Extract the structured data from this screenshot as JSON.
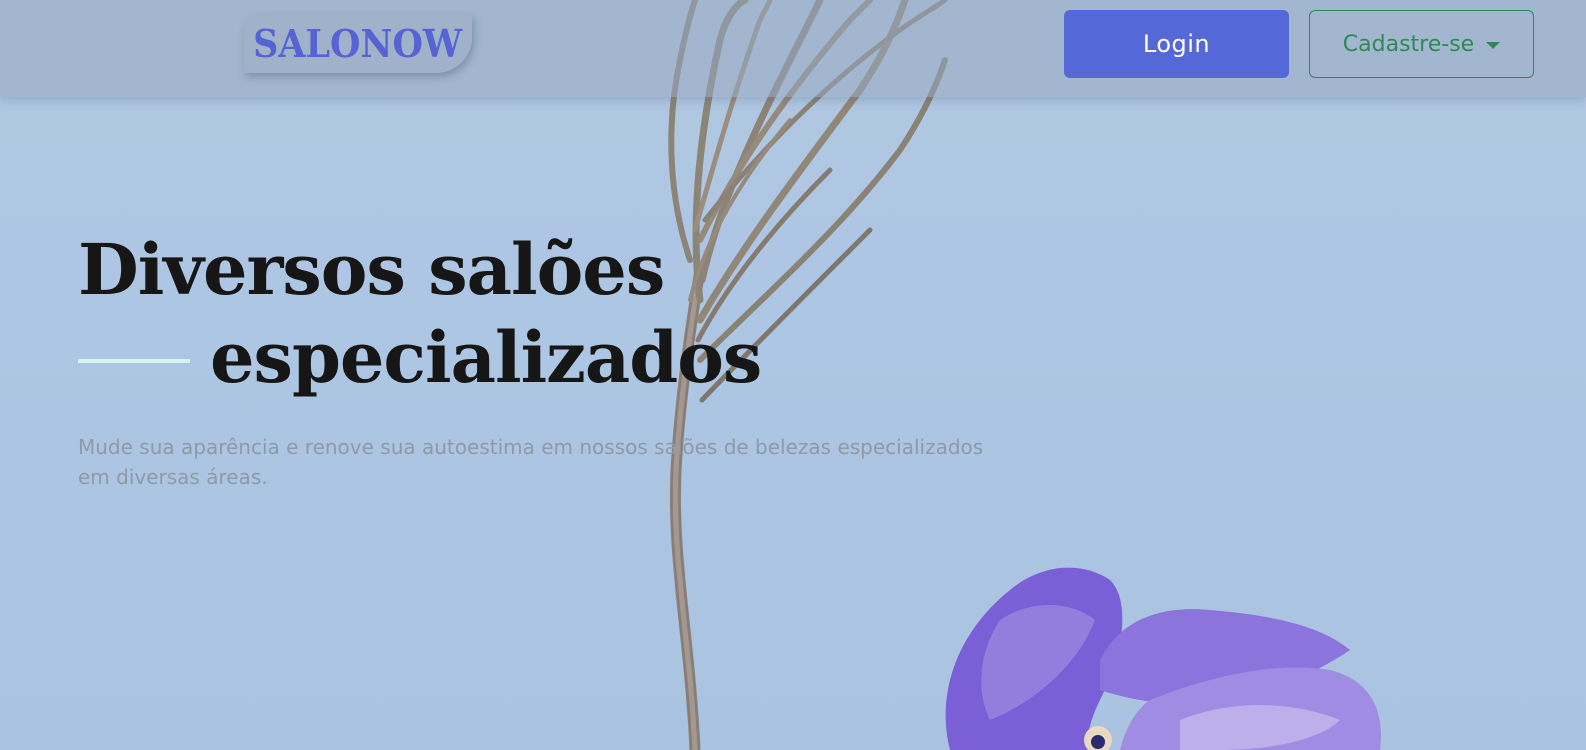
{
  "header": {
    "logo_text": "SALONOW",
    "login_label": "Login",
    "signup_label": "Cadastre-se"
  },
  "hero": {
    "title_line1": "Diversos salões",
    "title_line2": "especializados",
    "subtitle": "Mude sua aparência e renove sua autoestima em nossos salões de belezas especializados em diversas áreas."
  },
  "colors": {
    "brand": "#5564d2",
    "login_bg": "#5468d7",
    "signup_accent": "#2e8a55",
    "background": "#adc6e3"
  },
  "icons": {
    "signup_caret": "chevron-down-icon"
  }
}
